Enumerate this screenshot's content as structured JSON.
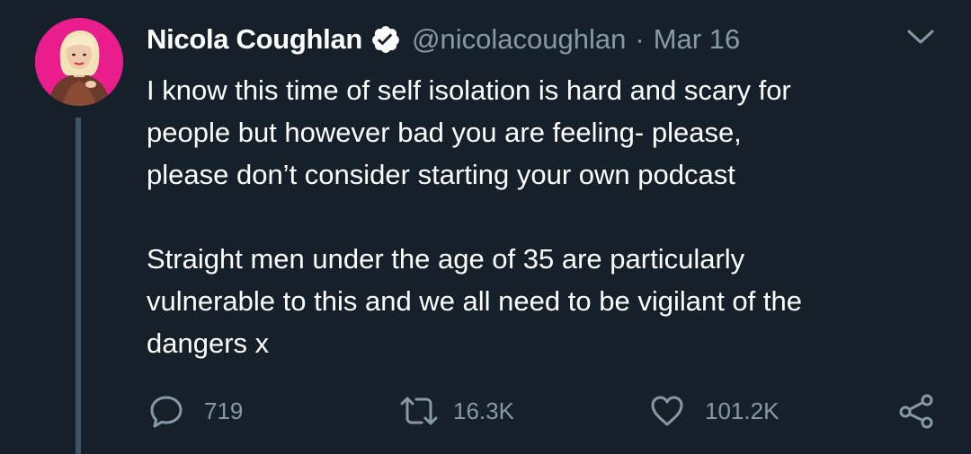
{
  "tweet": {
    "author": {
      "display_name": "Nicola Coughlan",
      "handle": "@nicolacoughlan",
      "verified": true,
      "avatar_description": "profile-photo"
    },
    "separator": "·",
    "date": "Mar 16",
    "text": "I know this time of self isolation is hard and scary for\npeople but however bad you are feeling- please,\nplease don’t consider starting your own podcast\n\nStraight men under the age of 35 are particularly\nvulnerable to this and we all need to be vigilant of the\ndangers  x",
    "actions": {
      "replies": "719",
      "retweets": "16.3K",
      "likes": "101.2K"
    }
  },
  "icons": {
    "verified": "verified-badge-icon",
    "menu": "chevron-down-icon",
    "reply": "reply-icon",
    "retweet": "retweet-icon",
    "like": "heart-icon",
    "share": "share-icon"
  },
  "colors": {
    "background": "#15202b",
    "text_primary": "#ffffff",
    "text_secondary": "#8899a6",
    "thread_line": "#3d5466",
    "avatar_background": "#e91e8c"
  }
}
